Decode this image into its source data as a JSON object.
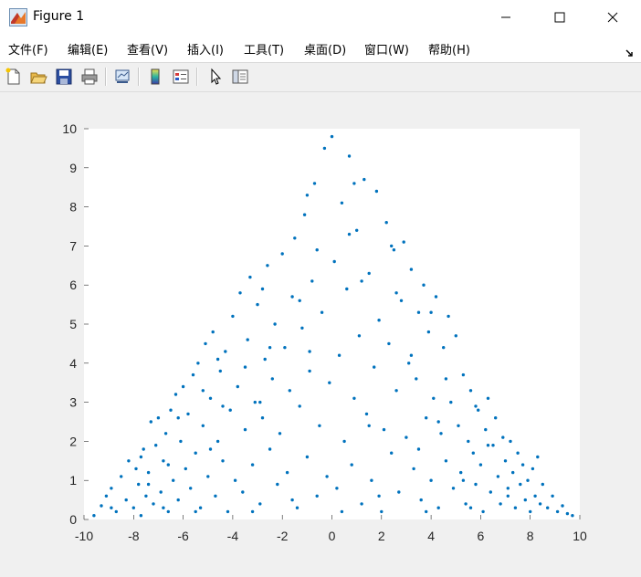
{
  "window": {
    "title": "Figure 1"
  },
  "menu": [
    {
      "label": "文件(F)"
    },
    {
      "label": "编辑(E)"
    },
    {
      "label": "查看(V)"
    },
    {
      "label": "插入(I)"
    },
    {
      "label": "工具(T)"
    },
    {
      "label": "桌面(D)"
    },
    {
      "label": "窗口(W)"
    },
    {
      "label": "帮助(H)"
    }
  ],
  "toolbar": {
    "icons": [
      "new-figure-icon",
      "open-file-icon",
      "save-icon",
      "print-icon",
      "link-plot-icon",
      "colorbar-icon",
      "legend-icon",
      "pointer-icon",
      "property-inspector-icon"
    ]
  },
  "colors": {
    "marker": "#0072bd",
    "axes_background": "#ffffff",
    "figure_background": "#f0f0f0"
  },
  "chart_data": {
    "type": "scatter",
    "title": "",
    "xlabel": "",
    "ylabel": "",
    "xlim": [
      -10,
      10
    ],
    "ylim": [
      0,
      10
    ],
    "xticks": [
      "-10",
      "-8",
      "-6",
      "-4",
      "-2",
      "0",
      "2",
      "4",
      "6",
      "8",
      "10"
    ],
    "yticks": [
      "0",
      "1",
      "2",
      "3",
      "4",
      "5",
      "6",
      "7",
      "8",
      "9",
      "10"
    ],
    "grid": false,
    "legend": "none",
    "series": [
      {
        "marker": "dot",
        "points": [
          [
            -9.6,
            0.1
          ],
          [
            -9.3,
            0.35
          ],
          [
            -9.1,
            0.6
          ],
          [
            -8.9,
            0.8
          ],
          [
            -8.7,
            0.2
          ],
          [
            -8.5,
            1.1
          ],
          [
            -8.3,
            0.5
          ],
          [
            -8.2,
            1.5
          ],
          [
            -8.0,
            0.3
          ],
          [
            -7.9,
            1.3
          ],
          [
            -7.8,
            0.9
          ],
          [
            -7.7,
            0.1
          ],
          [
            -7.6,
            1.8
          ],
          [
            -7.5,
            0.6
          ],
          [
            -7.4,
            1.2
          ],
          [
            -7.3,
            2.5
          ],
          [
            -7.2,
            0.4
          ],
          [
            -7.1,
            1.9
          ],
          [
            -7.0,
            2.6
          ],
          [
            -6.9,
            0.7
          ],
          [
            -6.8,
            1.5
          ],
          [
            -6.7,
            2.2
          ],
          [
            -6.6,
            0.2
          ],
          [
            -6.5,
            2.8
          ],
          [
            -6.4,
            1.0
          ],
          [
            -6.3,
            3.2
          ],
          [
            -6.2,
            0.5
          ],
          [
            -6.1,
            2.0
          ],
          [
            -6.0,
            3.4
          ],
          [
            -5.9,
            1.3
          ],
          [
            -5.8,
            2.7
          ],
          [
            -5.7,
            0.8
          ],
          [
            -5.6,
            3.7
          ],
          [
            -5.5,
            1.7
          ],
          [
            -5.4,
            4.0
          ],
          [
            -5.3,
            0.3
          ],
          [
            -5.2,
            2.4
          ],
          [
            -5.1,
            4.5
          ],
          [
            -5.0,
            1.1
          ],
          [
            -4.9,
            3.1
          ],
          [
            -4.8,
            4.8
          ],
          [
            -4.7,
            0.6
          ],
          [
            -4.6,
            2.0
          ],
          [
            -4.5,
            3.8
          ],
          [
            -4.4,
            1.5
          ],
          [
            -4.3,
            4.3
          ],
          [
            -4.2,
            0.2
          ],
          [
            -4.1,
            2.8
          ],
          [
            -4.0,
            5.2
          ],
          [
            -3.9,
            1.0
          ],
          [
            -3.8,
            3.4
          ],
          [
            -3.7,
            5.8
          ],
          [
            -3.6,
            0.7
          ],
          [
            -3.5,
            2.3
          ],
          [
            -3.4,
            4.6
          ],
          [
            -3.3,
            6.2
          ],
          [
            -3.2,
            1.4
          ],
          [
            -3.1,
            3.0
          ],
          [
            -3.0,
            5.5
          ],
          [
            -2.9,
            0.4
          ],
          [
            -2.8,
            2.6
          ],
          [
            -2.7,
            4.1
          ],
          [
            -2.6,
            6.5
          ],
          [
            -2.5,
            1.8
          ],
          [
            -2.4,
            3.6
          ],
          [
            -2.3,
            5.0
          ],
          [
            -2.2,
            0.9
          ],
          [
            -2.1,
            2.2
          ],
          [
            -2.0,
            6.8
          ],
          [
            -1.9,
            4.4
          ],
          [
            -1.8,
            1.2
          ],
          [
            -1.7,
            3.3
          ],
          [
            -1.6,
            5.7
          ],
          [
            -1.5,
            7.2
          ],
          [
            -1.4,
            0.3
          ],
          [
            -1.3,
            2.9
          ],
          [
            -1.2,
            4.9
          ],
          [
            -1.1,
            7.8
          ],
          [
            -1.0,
            1.6
          ],
          [
            -0.9,
            3.8
          ],
          [
            -0.8,
            6.1
          ],
          [
            -0.7,
            8.6
          ],
          [
            -0.6,
            0.6
          ],
          [
            -0.5,
            2.4
          ],
          [
            -0.4,
            5.3
          ],
          [
            -0.3,
            9.5
          ],
          [
            -0.2,
            1.1
          ],
          [
            -0.1,
            3.5
          ],
          [
            0.0,
            9.8
          ],
          [
            0.1,
            6.6
          ],
          [
            0.2,
            0.8
          ],
          [
            0.3,
            4.2
          ],
          [
            0.4,
            8.1
          ],
          [
            0.5,
            2.0
          ],
          [
            0.6,
            5.9
          ],
          [
            0.7,
            9.3
          ],
          [
            0.8,
            1.4
          ],
          [
            0.9,
            3.1
          ],
          [
            1.0,
            7.4
          ],
          [
            1.1,
            4.7
          ],
          [
            1.2,
            0.4
          ],
          [
            1.3,
            8.7
          ],
          [
            1.4,
            2.7
          ],
          [
            1.5,
            6.3
          ],
          [
            1.6,
            1.0
          ],
          [
            1.7,
            3.9
          ],
          [
            1.8,
            8.4
          ],
          [
            1.9,
            5.1
          ],
          [
            2.0,
            0.2
          ],
          [
            2.1,
            2.3
          ],
          [
            2.2,
            7.6
          ],
          [
            2.3,
            4.5
          ],
          [
            2.4,
            1.7
          ],
          [
            2.5,
            6.9
          ],
          [
            2.6,
            3.3
          ],
          [
            2.7,
            0.7
          ],
          [
            2.8,
            5.6
          ],
          [
            2.9,
            7.1
          ],
          [
            3.0,
            2.1
          ],
          [
            3.1,
            4.0
          ],
          [
            3.2,
            6.4
          ],
          [
            3.3,
            1.3
          ],
          [
            3.4,
            3.6
          ],
          [
            3.5,
            5.3
          ],
          [
            3.6,
            0.5
          ],
          [
            3.7,
            6.0
          ],
          [
            3.8,
            2.6
          ],
          [
            3.9,
            4.8
          ],
          [
            4.0,
            1.0
          ],
          [
            4.1,
            3.1
          ],
          [
            4.2,
            5.7
          ],
          [
            4.3,
            0.3
          ],
          [
            4.4,
            2.2
          ],
          [
            4.5,
            4.4
          ],
          [
            4.6,
            1.5
          ],
          [
            4.7,
            5.2
          ],
          [
            4.8,
            3.0
          ],
          [
            4.9,
            0.8
          ],
          [
            5.0,
            4.7
          ],
          [
            5.1,
            2.4
          ],
          [
            5.2,
            1.2
          ],
          [
            5.3,
            3.7
          ],
          [
            5.4,
            0.4
          ],
          [
            5.5,
            2.0
          ],
          [
            5.6,
            3.3
          ],
          [
            5.7,
            1.7
          ],
          [
            5.8,
            0.9
          ],
          [
            5.9,
            2.8
          ],
          [
            6.0,
            1.4
          ],
          [
            6.1,
            0.2
          ],
          [
            6.2,
            2.3
          ],
          [
            6.3,
            3.1
          ],
          [
            6.4,
            0.7
          ],
          [
            6.5,
            1.9
          ],
          [
            6.6,
            2.6
          ],
          [
            6.7,
            1.1
          ],
          [
            6.8,
            0.4
          ],
          [
            6.9,
            2.1
          ],
          [
            7.0,
            1.5
          ],
          [
            7.1,
            0.8
          ],
          [
            7.2,
            2.0
          ],
          [
            7.3,
            1.2
          ],
          [
            7.4,
            0.3
          ],
          [
            7.5,
            1.7
          ],
          [
            7.6,
            0.9
          ],
          [
            7.7,
            1.4
          ],
          [
            7.8,
            0.5
          ],
          [
            7.9,
            1.0
          ],
          [
            8.0,
            0.2
          ],
          [
            8.1,
            1.3
          ],
          [
            8.2,
            0.6
          ],
          [
            8.3,
            1.6
          ],
          [
            8.4,
            0.4
          ],
          [
            8.5,
            0.9
          ],
          [
            8.7,
            0.3
          ],
          [
            8.9,
            0.6
          ],
          [
            9.1,
            0.2
          ],
          [
            9.3,
            0.35
          ],
          [
            9.5,
            0.15
          ],
          [
            9.7,
            0.1
          ],
          [
            -5.5,
            0.2
          ],
          [
            -3.2,
            0.2
          ],
          [
            -1.6,
            0.5
          ],
          [
            0.4,
            0.2
          ],
          [
            1.9,
            0.6
          ],
          [
            3.8,
            0.2
          ],
          [
            5.6,
            0.3
          ],
          [
            -6.6,
            1.4
          ],
          [
            -4.4,
            2.9
          ],
          [
            -2.5,
            4.4
          ],
          [
            -0.6,
            6.9
          ],
          [
            1.2,
            6.1
          ],
          [
            3.2,
            4.2
          ],
          [
            4.6,
            3.6
          ],
          [
            6.3,
            1.9
          ],
          [
            -7.4,
            0.9
          ],
          [
            -5.2,
            3.3
          ],
          [
            -3.5,
            3.9
          ],
          [
            -1.3,
            5.6
          ],
          [
            0.9,
            8.6
          ],
          [
            2.6,
            5.8
          ],
          [
            4.3,
            2.5
          ],
          [
            -6.8,
            0.3
          ],
          [
            -4.9,
            1.8
          ],
          [
            -2.9,
            3.0
          ],
          [
            -0.9,
            4.3
          ],
          [
            1.5,
            2.4
          ],
          [
            3.5,
            1.8
          ],
          [
            5.3,
            1.0
          ],
          [
            7.1,
            0.6
          ],
          [
            -8.9,
            0.3
          ],
          [
            -7.7,
            1.6
          ],
          [
            -6.2,
            2.6
          ],
          [
            -4.6,
            4.1
          ],
          [
            -2.8,
            5.9
          ],
          [
            -1.0,
            8.3
          ],
          [
            0.7,
            7.3
          ],
          [
            2.4,
            7.0
          ],
          [
            4.0,
            5.3
          ],
          [
            5.8,
            2.9
          ]
        ]
      }
    ]
  }
}
